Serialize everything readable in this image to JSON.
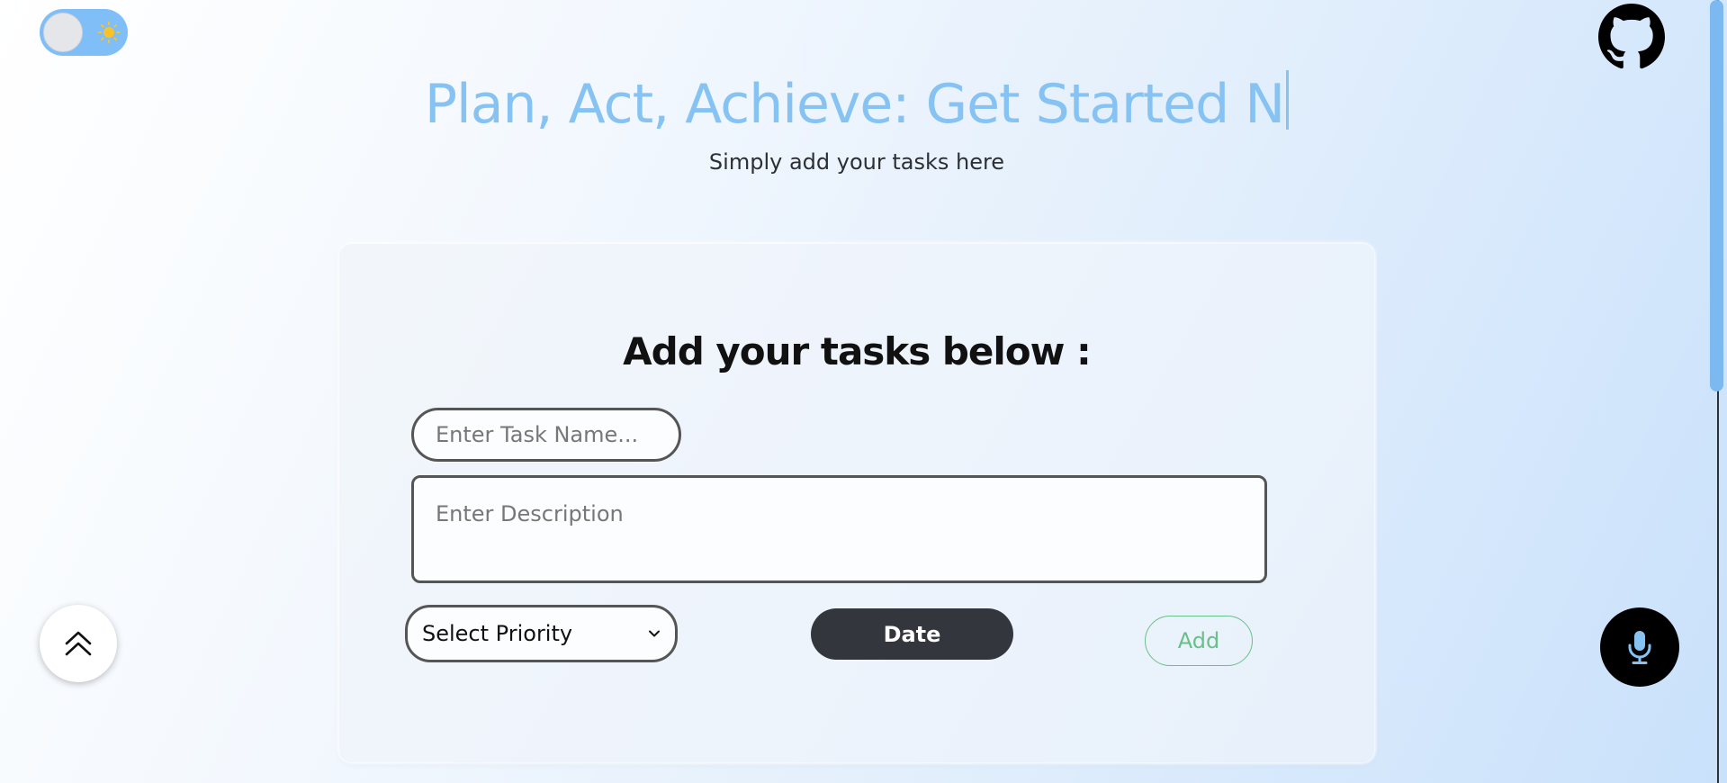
{
  "theme_toggle": {
    "state": "light",
    "icon": "sun-icon",
    "track_color": "#7fbef6",
    "sun_color": "#f8c22b"
  },
  "header": {
    "title": "Plan, Act, Achieve: Get Started N",
    "title_color": "#86c3f3",
    "subtitle": "Simply add your tasks here"
  },
  "github": {
    "icon": "github-icon"
  },
  "form": {
    "heading": "Add your tasks below :",
    "task_name_placeholder": "Enter Task Name...",
    "description_placeholder": "Enter Description",
    "priority_selected": "Select Priority",
    "date_label": "Date",
    "add_label": "Add",
    "add_color": "#69c08a",
    "date_bg": "#33373d"
  },
  "floating": {
    "scroll_top_icon": "double-chevron-up-icon",
    "mic_icon": "microphone-icon",
    "mic_icon_color": "#86c3f3"
  }
}
